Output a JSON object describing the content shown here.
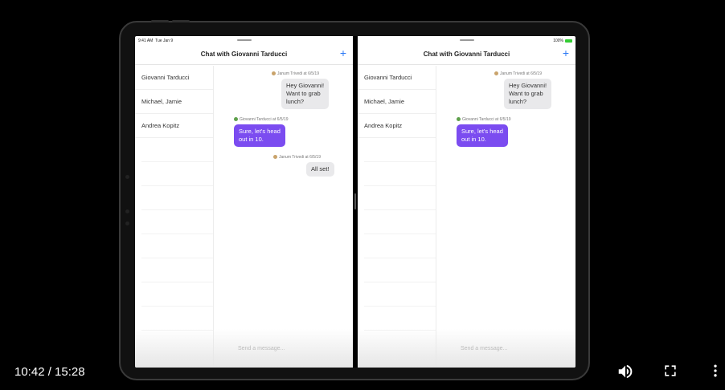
{
  "player": {
    "timecode": "10:42 / 15:28",
    "volume_icon": "volume-icon",
    "fullscreen_icon": "fullscreen-icon",
    "more_icon": "more-vert-icon"
  },
  "status_bar": {
    "time": "9:41 AM",
    "date": "Tue Jan 9",
    "battery": "100%"
  },
  "left_pane": {
    "nav_title": "Chat with Giovanni Tarducci",
    "add_label": "+",
    "contacts": [
      "Giovanni Tarducci",
      "Michael, Jamie",
      "Andrea Kopitz"
    ],
    "messages": [
      {
        "meta": "Janum Trivedi at 6/5/19",
        "text1": "Hey Giovanni!",
        "text2": "Want to grab",
        "text3": "lunch?"
      },
      {
        "meta": "Giovanni Tarducci at 6/5/19",
        "text1": "Sure, let's head",
        "text2": "out in 10."
      },
      {
        "meta": "Janum Trivedi at 6/5/19",
        "text1": "All set!"
      }
    ],
    "composer_placeholder": "Send a message..."
  },
  "right_pane": {
    "nav_title": "Chat with Giovanni Tarducci",
    "add_label": "+",
    "contacts": [
      "Giovanni Tarducci",
      "Michael, Jamie",
      "Andrea Kopitz"
    ],
    "messages": [
      {
        "meta": "Janum Trivedi at 6/5/19",
        "text1": "Hey Giovanni!",
        "text2": "Want to grab",
        "text3": "lunch?"
      },
      {
        "meta": "Giovanni Tarducci at 6/5/19",
        "text1": "Sure, let's head",
        "text2": "out in 10."
      }
    ],
    "composer_placeholder": "Send a message..."
  },
  "colors": {
    "accent": "#2f7bf6",
    "outgoing_bubble": "#7b4cf0",
    "incoming_bubble": "#e9e9eb"
  }
}
